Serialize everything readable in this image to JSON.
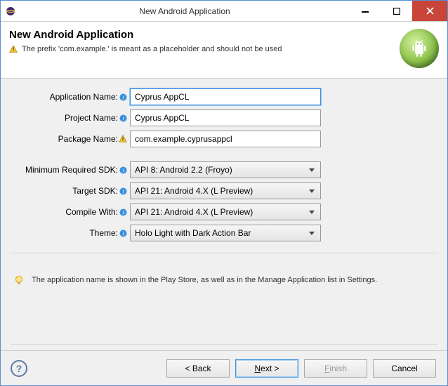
{
  "titlebar": {
    "title": "New Android Application"
  },
  "header": {
    "heading": "New Android Application",
    "warning": "The prefix 'com.example.' is meant as a placeholder and should not be used"
  },
  "form": {
    "appName": {
      "label": "Application Name:",
      "value": "Cyprus AppCL"
    },
    "projName": {
      "label": "Project Name:",
      "value": "Cyprus AppCL"
    },
    "pkgName": {
      "label": "Package Name:",
      "value": "com.example.cyprusappcl"
    },
    "minSdk": {
      "label": "Minimum Required SDK:",
      "value": "API 8: Android 2.2 (Froyo)"
    },
    "targetSdk": {
      "label": "Target SDK:",
      "value": "API 21: Android 4.X (L Preview)"
    },
    "compile": {
      "label": "Compile With:",
      "value": "API 21: Android 4.X (L Preview)"
    },
    "theme": {
      "label": "Theme:",
      "value": "Holo Light with Dark Action Bar"
    }
  },
  "hint": "The application name is shown in the Play Store, as well as in the Manage Application list in Settings.",
  "buttons": {
    "back": "< Back",
    "next_prefix": "N",
    "next_rest": "ext >",
    "finish_prefix": "F",
    "finish_rest": "inish",
    "cancel": "Cancel"
  }
}
